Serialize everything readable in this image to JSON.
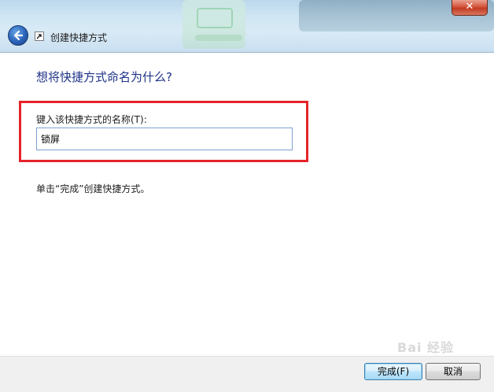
{
  "window": {
    "title": "创建快捷方式",
    "close_label": "✕"
  },
  "main": {
    "heading": "想将快捷方式命名为什么?",
    "field_label": "键入该快捷方式的名称(T):",
    "name_value": "锁屏",
    "instruction": "单击“完成”创建快捷方式。"
  },
  "footer": {
    "finish_label": "完成(F)",
    "cancel_label": "取消"
  },
  "watermark": {
    "text": "Bai 经验"
  },
  "icons": {
    "back": "back-arrow-icon",
    "shortcut": "shortcut-icon",
    "close": "close-icon"
  },
  "colors": {
    "heading": "#1e3287",
    "highlight": "#e5232a",
    "input_border": "#7da2ce"
  }
}
